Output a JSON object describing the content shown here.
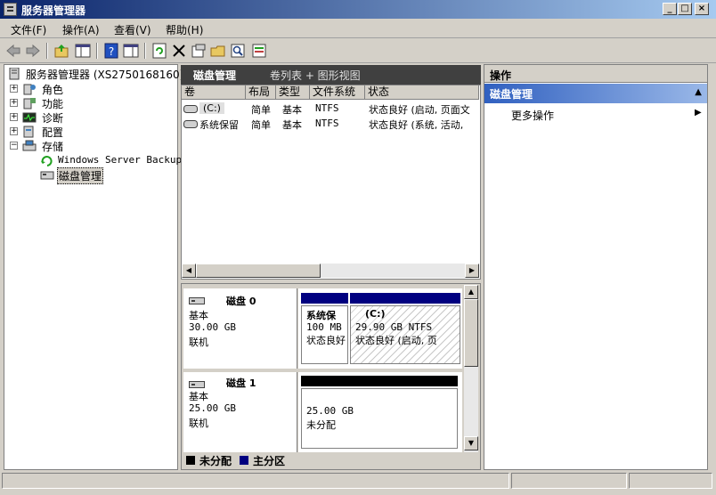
{
  "window": {
    "title": "服务器管理器"
  },
  "window_buttons": {
    "minimize": "_",
    "maximize": "□",
    "close": "×"
  },
  "menu": [
    "文件(F)",
    "操作(A)",
    "查看(V)",
    "帮助(H)"
  ],
  "toolbar_icons": [
    "back-icon",
    "forward-icon",
    "up-folder-icon",
    "show-hide-tree-icon",
    "help-icon",
    "show-hide-action-icon",
    "refresh-icon",
    "delete-icon",
    "properties-icon",
    "open-icon",
    "search-icon",
    "export-icon"
  ],
  "tree": {
    "root": "服务器管理器 (XS2750168160)",
    "items": [
      {
        "label": "角色",
        "expander": "+"
      },
      {
        "label": "功能",
        "expander": "+"
      },
      {
        "label": "诊断",
        "expander": "+"
      },
      {
        "label": "配置",
        "expander": "+"
      },
      {
        "label": "存储",
        "expander": "−"
      }
    ],
    "storage_children": [
      "Windows Server Backup",
      "磁盘管理"
    ]
  },
  "center": {
    "title": "磁盘管理",
    "views": "卷列表 + 图形视图",
    "columns": [
      "卷",
      "布局",
      "类型",
      "文件系统",
      "状态"
    ],
    "rows": [
      {
        "volume": "(C:)",
        "layout": "简单",
        "type": "基本",
        "fs": "NTFS",
        "status": "状态良好 (启动, 页面文"
      },
      {
        "volume": "系统保留",
        "layout": "简单",
        "type": "基本",
        "fs": "NTFS",
        "status": "状态良好 (系统, 活动,"
      }
    ],
    "disks": [
      {
        "name": "磁盘 0",
        "kind": "基本",
        "size": "30.00 GB",
        "state": "联机",
        "partitions": [
          {
            "name": "系统保",
            "size": "100 MB",
            "status": "状态良好"
          },
          {
            "name": "(C:)",
            "size": "29.90 GB NTFS",
            "status": "状态良好 (启动, 页"
          }
        ]
      },
      {
        "name": "磁盘 1",
        "kind": "基本",
        "size": "25.00 GB",
        "state": "联机",
        "partitions": [
          {
            "name": "",
            "size": "25.00 GB",
            "status": "未分配"
          }
        ]
      }
    ],
    "legend": [
      {
        "label": "未分配",
        "color": "#000000"
      },
      {
        "label": "主分区",
        "color": "#000080"
      }
    ]
  },
  "actions": {
    "header": "操作",
    "section": "磁盘管理",
    "items": [
      "更多操作"
    ]
  },
  "colors": {
    "title_bar": "#0a246a",
    "primary_partition": "#000080",
    "unallocated": "#000000",
    "action_section": "#3060c0"
  }
}
